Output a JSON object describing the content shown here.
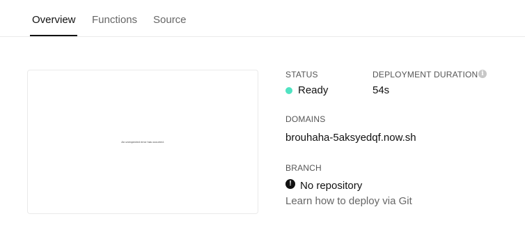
{
  "tabs": [
    {
      "label": "Overview",
      "active": true
    },
    {
      "label": "Functions",
      "active": false
    },
    {
      "label": "Source",
      "active": false
    }
  ],
  "preview": {
    "message": "An unexpected error has occurred."
  },
  "status": {
    "label": "STATUS",
    "value": "Ready",
    "color": "#50e3c2"
  },
  "duration": {
    "label": "DEPLOYMENT DURATION",
    "value": "54s",
    "info_icon": "info-icon"
  },
  "domains": {
    "label": "DOMAINS",
    "items": [
      "brouhaha-5aksyedqf.now.sh"
    ]
  },
  "branch": {
    "label": "BRANCH",
    "icon": "alert-icon",
    "value": "No repository",
    "help_link": "Learn how to deploy via Git"
  }
}
